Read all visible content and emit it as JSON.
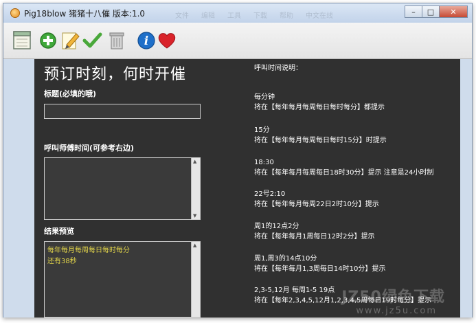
{
  "window": {
    "title": "Pig18blow 猪猪十八催 版本:1.0",
    "menu_ghost": [
      "文件",
      "编辑",
      "工具",
      "下载",
      "帮助",
      "中文在线"
    ]
  },
  "toolbar": {
    "icons": [
      "calendar-icon",
      "add-icon",
      "edit-icon",
      "check-icon",
      "trash-icon",
      "info-icon",
      "heart-icon"
    ]
  },
  "form": {
    "heading": "预订时刻，何时开催",
    "title_label": "标题(必填的哦)",
    "title_value": "",
    "time_label": "呼叫师傅时间(可参考右边)",
    "time_value": "",
    "preview_label": "结果预览",
    "preview_lines": [
      "每年每月每周每日每时每分",
      "还有38秒"
    ]
  },
  "help": {
    "title": "呼叫时间说明：",
    "items": [
      {
        "example": "每分钟",
        "desc": "将在【每年每月每周每日每时每分】都提示"
      },
      {
        "example": "15分",
        "desc": "将在【每年每月每周每日每时15分】时提示"
      },
      {
        "example": "18:30",
        "desc": "将在【每年每月每周每日18时30分】提示 注意是24小时制"
      },
      {
        "example": "22号2:10",
        "desc": "将在【每年每月每周22日2时10分】提示"
      },
      {
        "example": "周1的12点2分",
        "desc": "将在【每年每月1周每日12时2分】提示"
      },
      {
        "example": "周1,周3的14点10分",
        "desc": "将在【每年每月1,3周每日14时10分】提示"
      },
      {
        "example": "2,3-5,12月 每周1-5 19点",
        "desc": "将在【每年2,3,4,5,12月1,2,3,4,5周每日19时每分】提示"
      }
    ]
  },
  "watermark": {
    "line1": "JZ50绿色下载",
    "line2": "www.jz5u.com"
  }
}
